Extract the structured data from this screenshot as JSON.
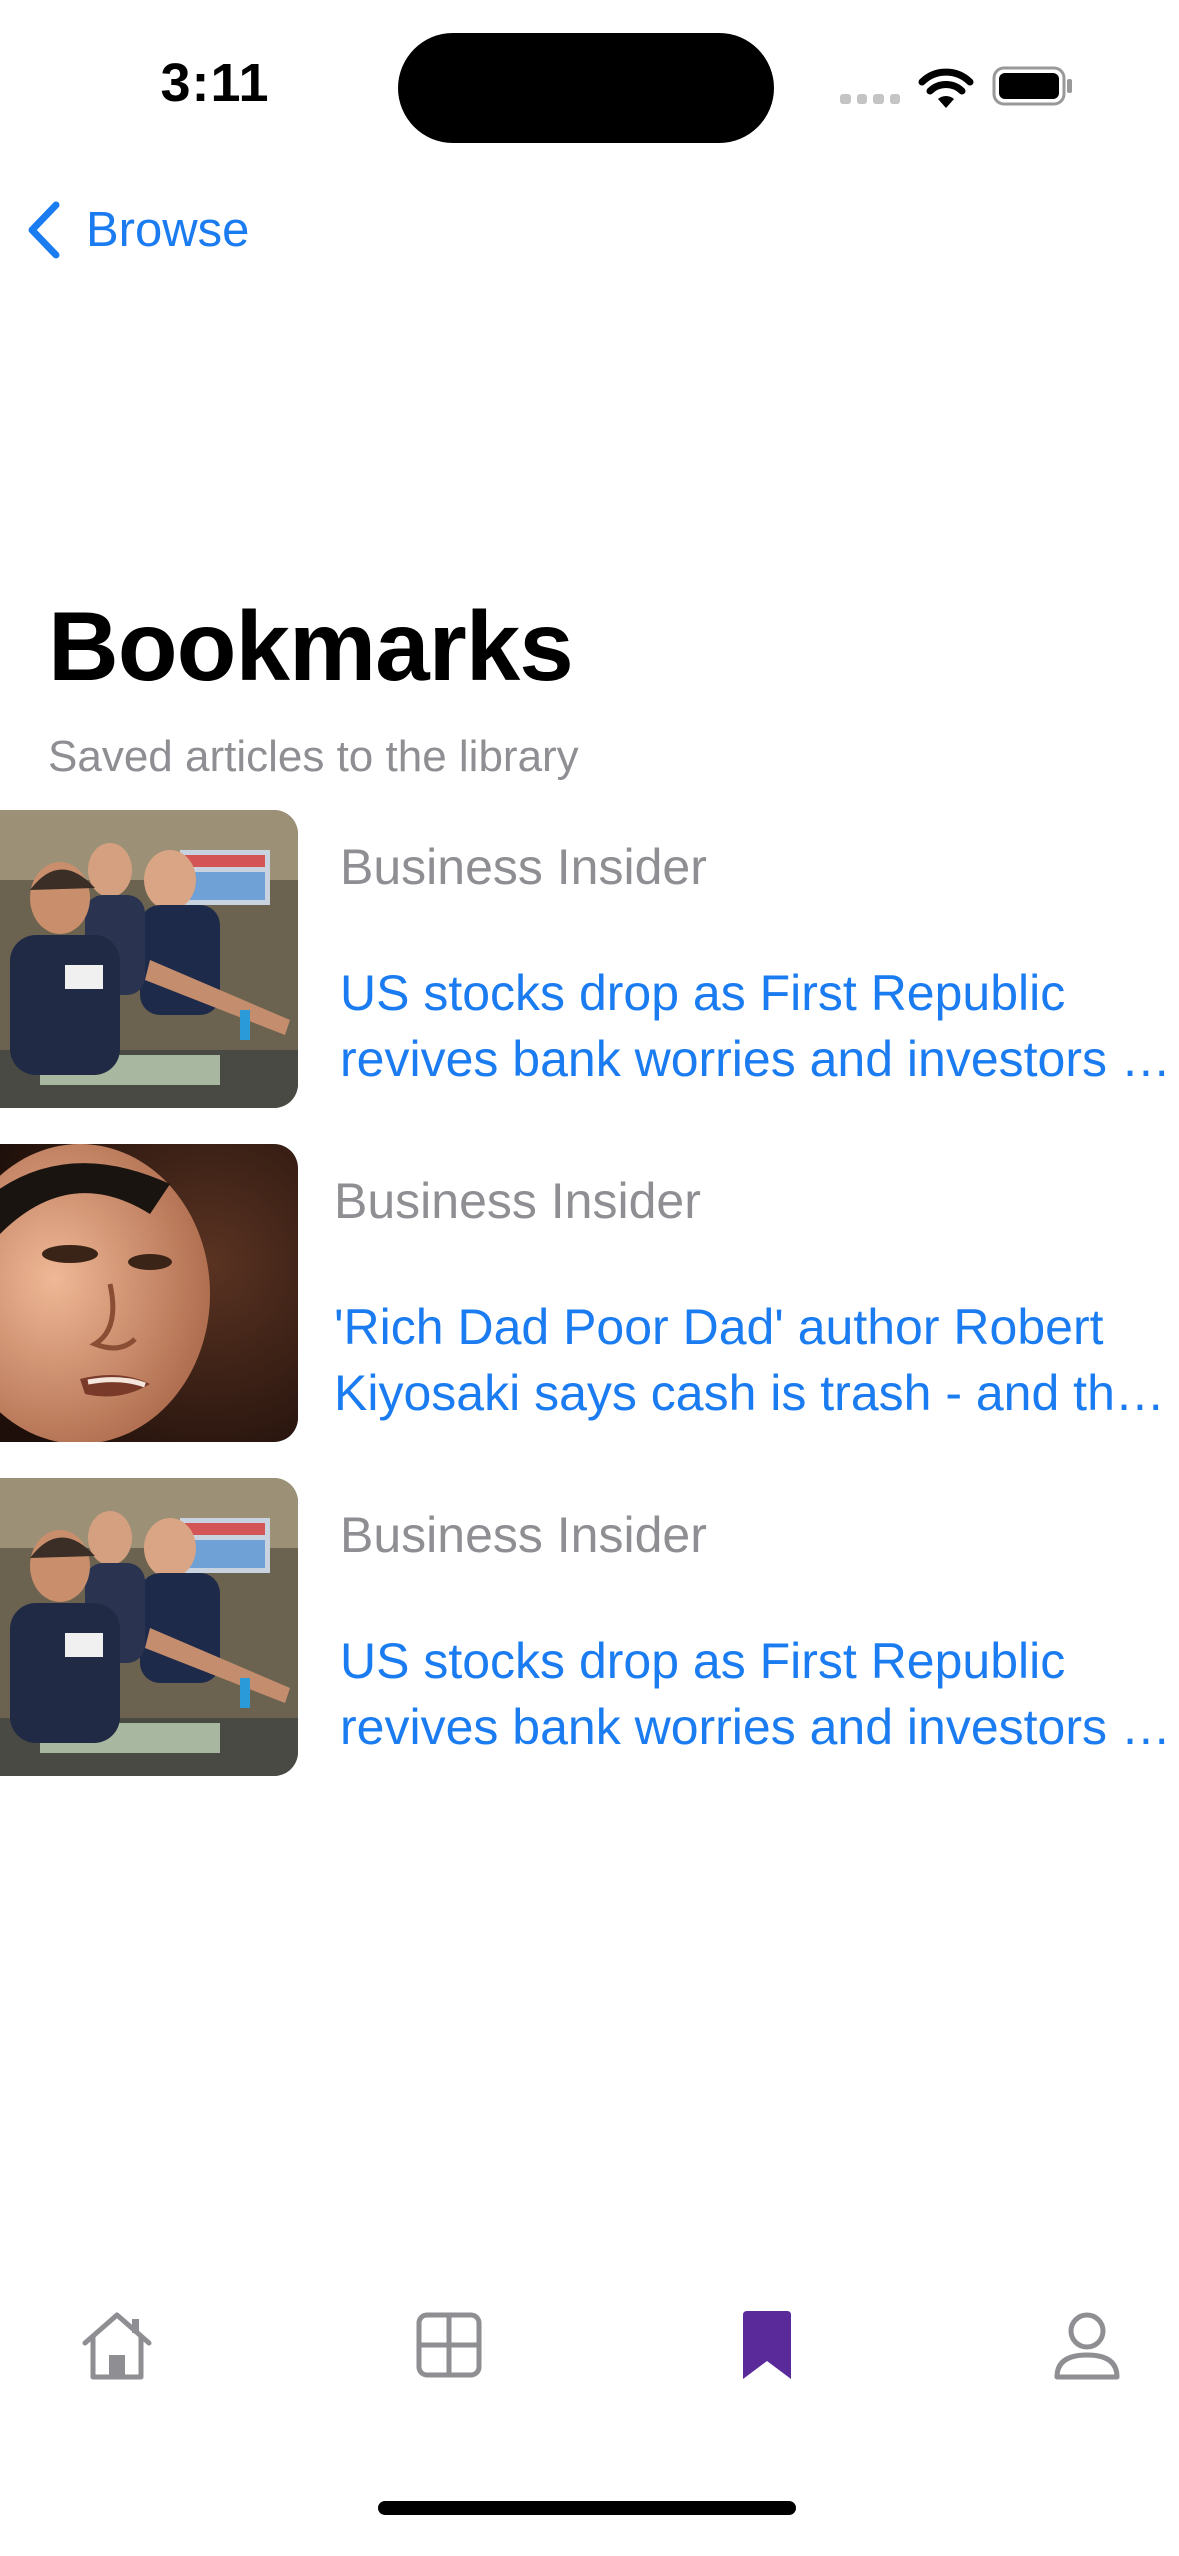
{
  "status_bar": {
    "time": "3:11"
  },
  "nav": {
    "back_label": "Browse"
  },
  "header": {
    "title": "Bookmarks",
    "subtitle": "Saved articles to the library"
  },
  "articles": [
    {
      "source": "Business Insider",
      "headline_line1": "US stocks drop as First Republic",
      "headline_line2": "revives bank worries and investors weigh earnings",
      "image": "traders-photo"
    },
    {
      "source": "Business Insider",
      "headline_line1": "'Rich Dad Poor Dad' author Robert",
      "headline_line2": "Kiyosaki says cash is trash - and the dollar is doomed",
      "image": "portrait-photo"
    },
    {
      "source": "Business Insider",
      "headline_line1": "US stocks drop as First Republic",
      "headline_line2": "revives bank worries and investors weigh earnings",
      "image": "traders-photo"
    }
  ],
  "tab_bar": {
    "tabs": [
      {
        "icon": "home-icon",
        "active": false
      },
      {
        "icon": "grid-icon",
        "active": false
      },
      {
        "icon": "bookmark-icon",
        "active": true
      },
      {
        "icon": "person-icon",
        "active": false
      }
    ]
  },
  "colors": {
    "accent": "#1a7cf0",
    "secondary_text": "#8e8e93",
    "tab_active": "#5b2a9a",
    "tab_inactive": "#8e8e93"
  }
}
